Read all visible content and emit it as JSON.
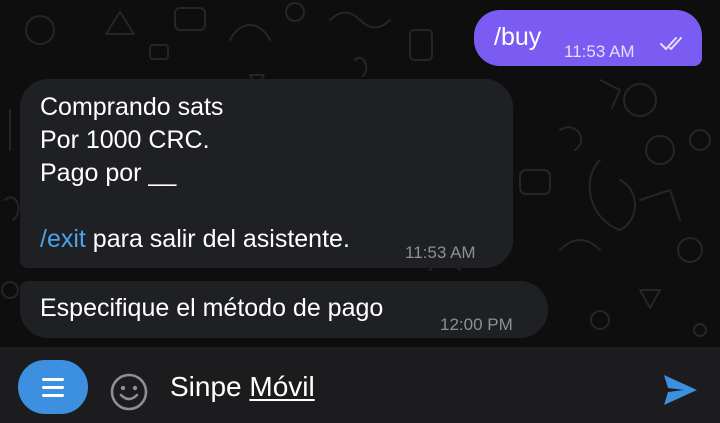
{
  "colors": {
    "outgoing_bubble": "#7a5cf2",
    "incoming_bubble": "#1f2023",
    "link": "#4aa3ea",
    "menu_button": "#3d8fe0",
    "send_icon": "#3d8fe0",
    "background": "#0e0e0e"
  },
  "messages": {
    "outgoing": {
      "text": "/buy",
      "time": "11:53 AM",
      "status_icon": "double-check-icon"
    },
    "bot_first": {
      "line1": "Comprando sats",
      "line2": "Por 1000 CRC.",
      "line3": "Pago por __",
      "command": "/exit",
      "command_rest": " para salir del asistente.",
      "time": "11:53 AM"
    },
    "bot_second": {
      "text": "Especifique el método de pago",
      "time": "12:00 PM"
    }
  },
  "input_bar": {
    "menu_icon": "menu-icon",
    "emoji_icon": "smile-icon",
    "text_part1": "Sinpe ",
    "text_part2": "Móvil",
    "send_icon": "send-icon"
  }
}
